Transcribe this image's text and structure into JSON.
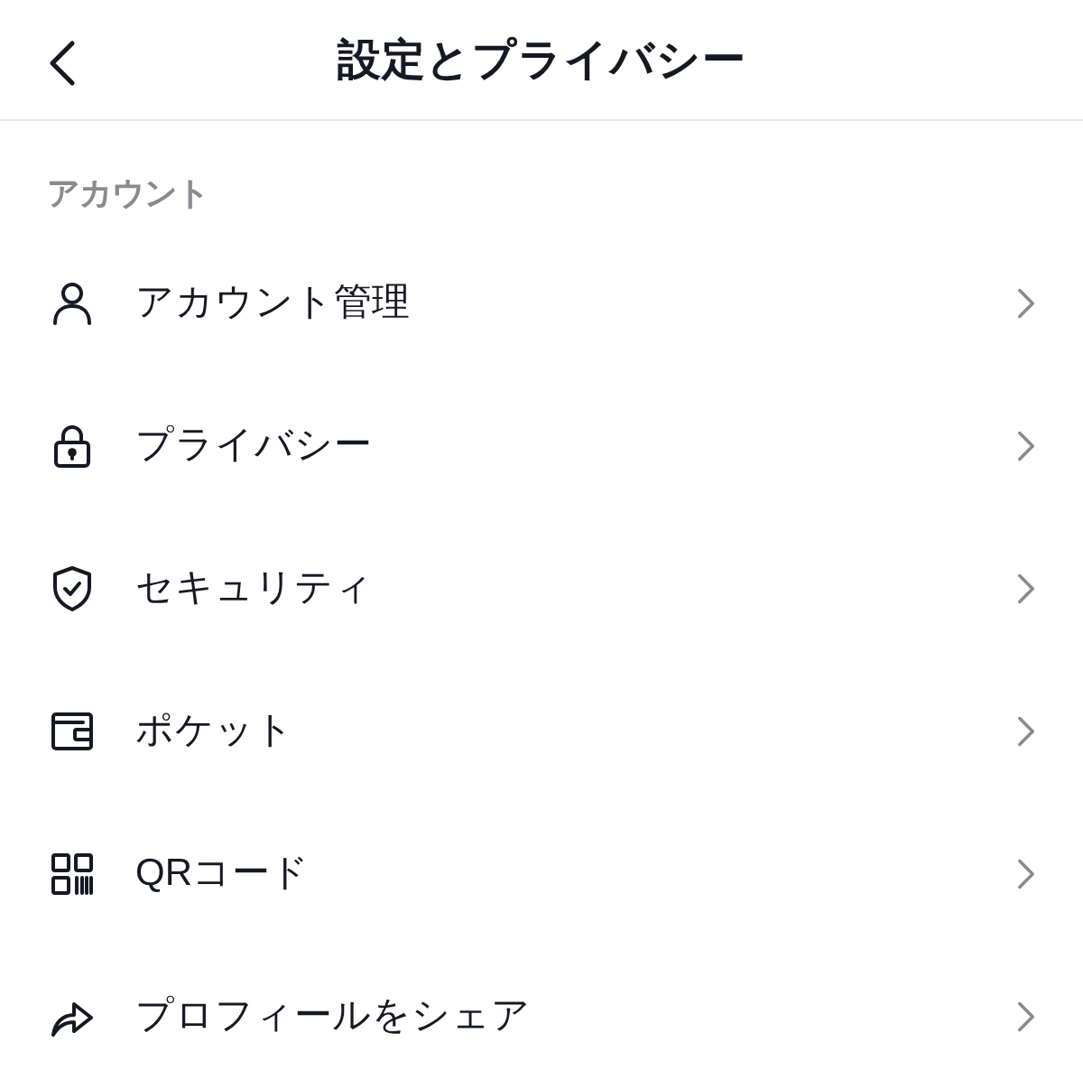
{
  "header": {
    "title": "設定とプライバシー"
  },
  "section": {
    "title": "アカウント",
    "items": [
      {
        "kind": "person",
        "label": "アカウント管理"
      },
      {
        "kind": "lock",
        "label": "プライバシー"
      },
      {
        "kind": "shield",
        "label": "セキュリティ"
      },
      {
        "kind": "wallet",
        "label": "ポケット"
      },
      {
        "kind": "qr",
        "label": "QRコード"
      },
      {
        "kind": "share",
        "label": "プロフィールをシェア"
      }
    ]
  }
}
